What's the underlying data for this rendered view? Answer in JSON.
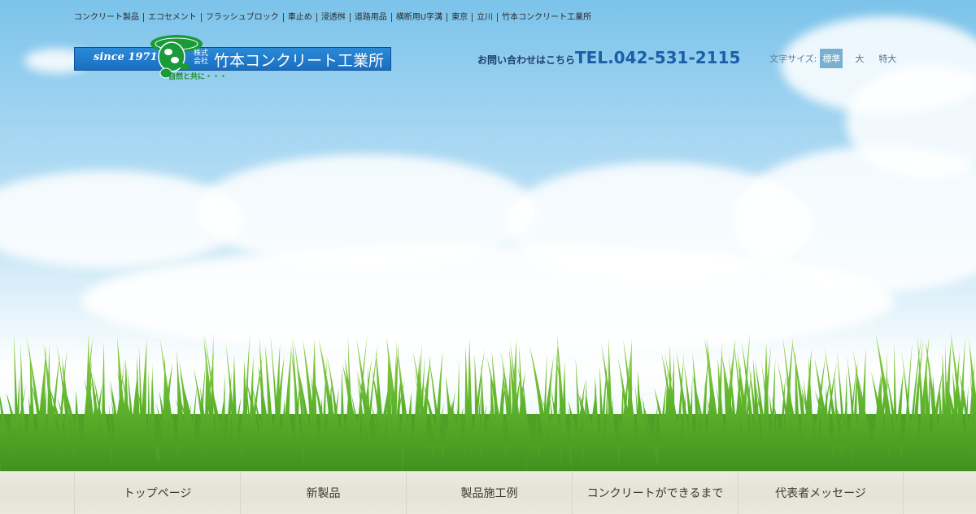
{
  "top_links": [
    "コンクリート製品",
    "エコセメント",
    "フラッシュブロック",
    "車止め",
    "浸透桝",
    "道路用品",
    "横断用U字溝",
    "東京",
    "立川",
    "竹本コンクリート工業所"
  ],
  "logo": {
    "since": "since 1971",
    "corp": "株式会社",
    "name": "竹本コンクリート工業所",
    "mark": "TAKEMOTO",
    "slogan": "自然と共に・・・"
  },
  "contact": {
    "label": "お問い合わせはこちら",
    "tel": "TEL.042-531-2115"
  },
  "font_size": {
    "label": "文字サイズ:",
    "options": [
      "標準",
      "大",
      "特大"
    ],
    "active": "標準"
  },
  "main_nav": [
    "トップページ",
    "新製品",
    "製品施工例",
    "コンクリートができるまで",
    "代表者メッセージ"
  ],
  "colors": {
    "brand_blue": "#1a6fc0",
    "tel_blue": "#1a5fa8",
    "grass_green": "#6cc23a"
  }
}
